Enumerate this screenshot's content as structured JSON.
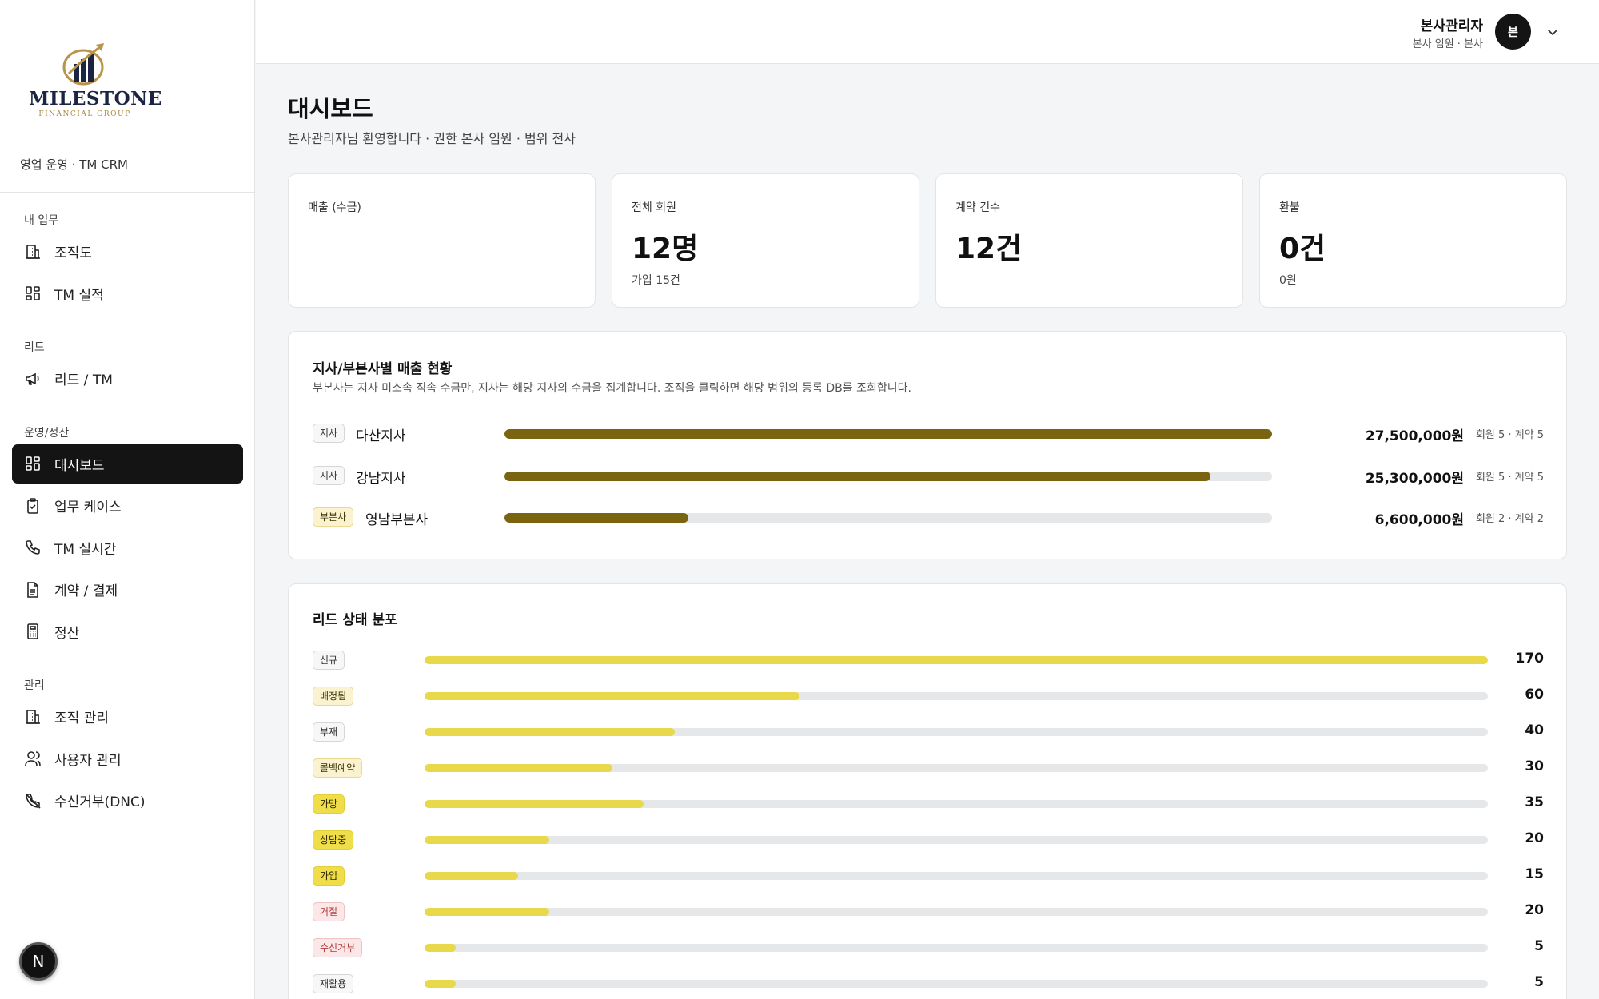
{
  "sidebar": {
    "app_sub": "영업 운영 · TM CRM",
    "logo": {
      "name": "MILESTONE",
      "sub": "FINANCIAL GROUP"
    },
    "sections": [
      {
        "title": "내 업무",
        "items": [
          {
            "label": "조직도",
            "icon": "building-icon"
          },
          {
            "label": "TM 실적",
            "icon": "grid-icon"
          }
        ]
      },
      {
        "title": "리드",
        "items": [
          {
            "label": "리드 / TM",
            "icon": "megaphone-icon"
          }
        ]
      },
      {
        "title": "운영/정산",
        "items": [
          {
            "label": "대시보드",
            "icon": "grid-icon",
            "active": true
          },
          {
            "label": "업무 케이스",
            "icon": "clipboard-check-icon"
          },
          {
            "label": "TM 실시간",
            "icon": "phone-icon"
          },
          {
            "label": "계약 / 결제",
            "icon": "document-icon"
          },
          {
            "label": "정산",
            "icon": "calculator-icon"
          }
        ]
      },
      {
        "title": "관리",
        "items": [
          {
            "label": "조직 관리",
            "icon": "building-icon"
          },
          {
            "label": "사용자 관리",
            "icon": "users-icon"
          },
          {
            "label": "수신거부(DNC)",
            "icon": "phone-off-icon"
          }
        ]
      }
    ],
    "badge": "N"
  },
  "topbar": {
    "user_name": "본사관리자",
    "user_role": "본사 임원 · 본사",
    "avatar": "본"
  },
  "page": {
    "title": "대시보드",
    "subtitle": "본사관리자님 환영합니다 · 권한 본사 임원 · 범위 전사"
  },
  "kpis": [
    {
      "label": "매출 (수금)",
      "value": "",
      "sub": ""
    },
    {
      "label": "전체 회원",
      "value": "12명",
      "sub": "가입 15건"
    },
    {
      "label": "계약 건수",
      "value": "12건",
      "sub": ""
    },
    {
      "label": "환불",
      "value": "0건",
      "sub": "0원"
    }
  ],
  "branch_card": {
    "title": "지사/부본사별 매출 현황",
    "desc": "부본사는 지사 미소속 직속 수금만, 지사는 해당 지사의 수금을 집계합니다. 조직을 클릭하면 해당 범위의 등록 DB를 조회합니다.",
    "rows": [
      {
        "tag": "지사",
        "tag_style": "gray",
        "name": "다산지사",
        "value": 27500000,
        "amount": "27,500,000원",
        "meta": "회원 5 · 계약 5"
      },
      {
        "tag": "지사",
        "tag_style": "gray",
        "name": "강남지사",
        "value": 25300000,
        "amount": "25,300,000원",
        "meta": "회원 5 · 계약 5"
      },
      {
        "tag": "부본사",
        "tag_style": "brand",
        "name": "영남부본사",
        "value": 6600000,
        "amount": "6,600,000원",
        "meta": "회원 2 · 계약 2"
      }
    ],
    "max": 27500000,
    "bar_color": "#7a6410"
  },
  "lead_card": {
    "title": "리드 상태 분포",
    "max": 170,
    "bar_color": "#e9d84a",
    "rows": [
      {
        "tag": "신규",
        "tag_style": "gray",
        "value": 170
      },
      {
        "tag": "배정됨",
        "tag_style": "cream",
        "value": 60
      },
      {
        "tag": "부재",
        "tag_style": "gray",
        "value": 40
      },
      {
        "tag": "콜백예약",
        "tag_style": "cream",
        "value": 30
      },
      {
        "tag": "가망",
        "tag_style": "yellow",
        "value": 35
      },
      {
        "tag": "상담중",
        "tag_style": "yellow",
        "value": 20
      },
      {
        "tag": "가입",
        "tag_style": "yellow",
        "value": 15
      },
      {
        "tag": "거절",
        "tag_style": "red",
        "value": 20
      },
      {
        "tag": "수신거부",
        "tag_style": "red",
        "value": 5
      },
      {
        "tag": "재활용",
        "tag_style": "gray",
        "value": 5
      }
    ]
  }
}
